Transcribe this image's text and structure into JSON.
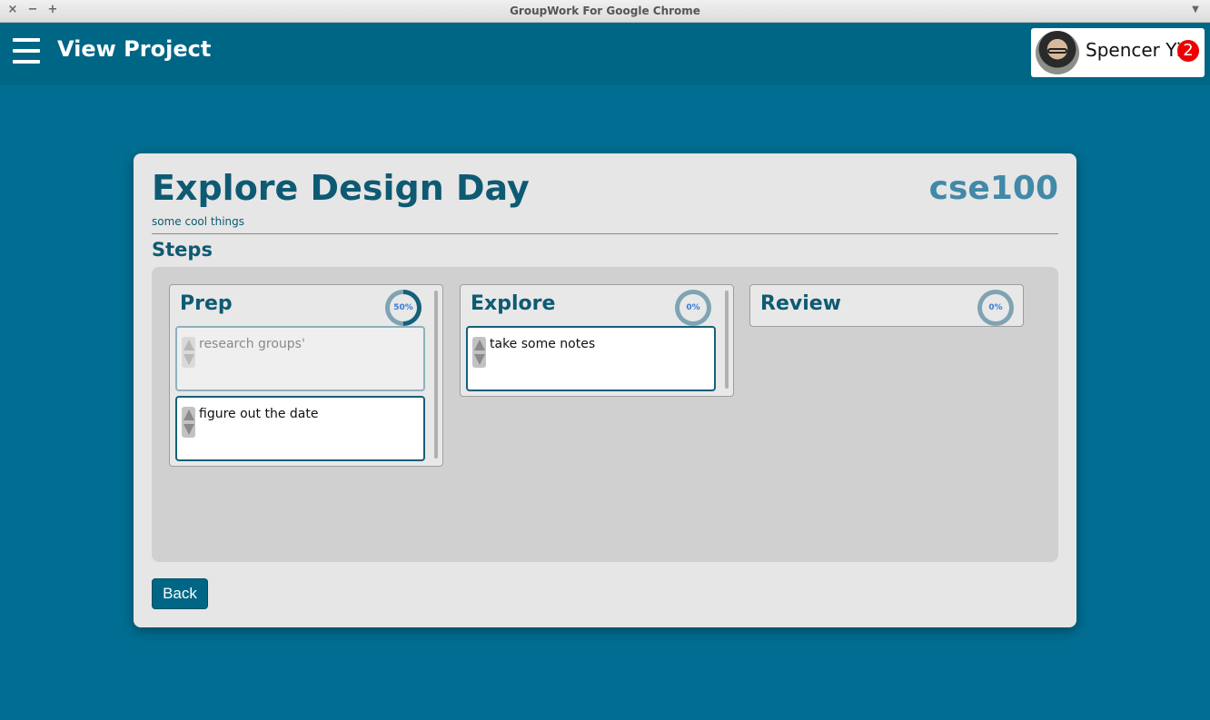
{
  "window": {
    "title": "GroupWork For Google Chrome",
    "close": "×",
    "minimize": "−",
    "maximize": "+",
    "menu": "▼"
  },
  "header": {
    "title": "View Project"
  },
  "user": {
    "name": "Spencer Yi",
    "notifications": "2"
  },
  "project": {
    "title": "Explore Design Day",
    "code": "cse100",
    "description": "some cool things",
    "steps_heading": "Steps",
    "back_label": "Back"
  },
  "steps": [
    {
      "name": "Prep",
      "progress_label": "50%",
      "progress": 0.5,
      "tasks": [
        {
          "text": "research groups'",
          "done": true
        },
        {
          "text": "figure out the date",
          "done": false
        }
      ]
    },
    {
      "name": "Explore",
      "progress_label": "0%",
      "progress": 0,
      "tasks": [
        {
          "text": "take some notes",
          "done": false
        }
      ]
    },
    {
      "name": "Review",
      "progress_label": "0%",
      "progress": 0,
      "tasks": []
    }
  ],
  "colors": {
    "accent": "#006686",
    "background": "#006e92",
    "heading": "#0e5a73",
    "code": "#4289a8",
    "ring_track": "#7fa3b3",
    "ring_fill": "#15607a",
    "badge": "#ee0000"
  }
}
